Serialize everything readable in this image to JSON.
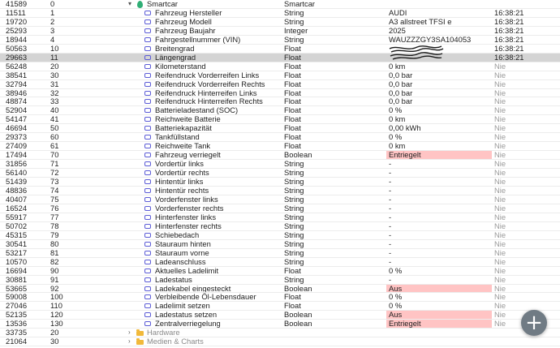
{
  "rows": [
    {
      "id": "41589",
      "num": "0",
      "name": "Smartcar",
      "type": "Smartcar",
      "value": "",
      "time": "",
      "kind": "group-open"
    },
    {
      "id": "11511",
      "num": "1",
      "name": "Fahrzeug Hersteller",
      "type": "String",
      "value": "AUDI",
      "time": "16:38:21",
      "kind": "var"
    },
    {
      "id": "19720",
      "num": "2",
      "name": "Fahrzeug Modell",
      "type": "String",
      "value": "A3 allstreet TFSI e",
      "time": "16:38:21",
      "kind": "var"
    },
    {
      "id": "25293",
      "num": "3",
      "name": "Fahrzeug Baujahr",
      "type": "Integer",
      "value": "2025",
      "time": "16:38:21",
      "kind": "var"
    },
    {
      "id": "18944",
      "num": "4",
      "name": "Fahrgestellnummer (VIN)",
      "type": "String",
      "value": "WAUZZZGY3SA104053",
      "time": "16:38:21",
      "kind": "var"
    },
    {
      "id": "50563",
      "num": "10",
      "name": "Breitengrad",
      "type": "Float",
      "value": "",
      "time": "16:38:21",
      "kind": "var"
    },
    {
      "id": "29663",
      "num": "11",
      "name": "Längengrad",
      "type": "Float",
      "value": "",
      "time": "16:38:21",
      "kind": "var",
      "selected": true
    },
    {
      "id": "56248",
      "num": "20",
      "name": "Kilometerstand",
      "type": "Float",
      "value": "0 km",
      "time": "Nie",
      "kind": "var"
    },
    {
      "id": "38541",
      "num": "30",
      "name": "Reifendruck Vorderreifen Links",
      "type": "Float",
      "value": "0,0 bar",
      "time": "Nie",
      "kind": "var"
    },
    {
      "id": "32794",
      "num": "31",
      "name": "Reifendruck Vorderreifen Rechts",
      "type": "Float",
      "value": "0,0 bar",
      "time": "Nie",
      "kind": "var"
    },
    {
      "id": "38946",
      "num": "32",
      "name": "Reifendruck Hinterreifen Links",
      "type": "Float",
      "value": "0,0 bar",
      "time": "Nie",
      "kind": "var"
    },
    {
      "id": "48874",
      "num": "33",
      "name": "Reifendruck Hinterreifen Rechts",
      "type": "Float",
      "value": "0,0 bar",
      "time": "Nie",
      "kind": "var"
    },
    {
      "id": "52904",
      "num": "40",
      "name": "Batterieladestand (SOC)",
      "type": "Float",
      "value": "0 %",
      "time": "Nie",
      "kind": "var"
    },
    {
      "id": "54147",
      "num": "41",
      "name": "Reichweite Batterie",
      "type": "Float",
      "value": "0 km",
      "time": "Nie",
      "kind": "var"
    },
    {
      "id": "46694",
      "num": "50",
      "name": "Batteriekapazität",
      "type": "Float",
      "value": "0,00 kWh",
      "time": "Nie",
      "kind": "var"
    },
    {
      "id": "29373",
      "num": "60",
      "name": "Tankfüllstand",
      "type": "Float",
      "value": "0 %",
      "time": "Nie",
      "kind": "var"
    },
    {
      "id": "27409",
      "num": "61",
      "name": "Reichweite Tank",
      "type": "Float",
      "value": "0 km",
      "time": "Nie",
      "kind": "var"
    },
    {
      "id": "17494",
      "num": "70",
      "name": "Fahrzeug verriegelt",
      "type": "Boolean",
      "value": "Entriegelt",
      "time": "Nie",
      "kind": "var",
      "highlight": true
    },
    {
      "id": "31856",
      "num": "71",
      "name": "Vordertür links",
      "type": "String",
      "value": "-",
      "time": "Nie",
      "kind": "var"
    },
    {
      "id": "56140",
      "num": "72",
      "name": "Vordertür rechts",
      "type": "String",
      "value": "-",
      "time": "Nie",
      "kind": "var"
    },
    {
      "id": "51439",
      "num": "73",
      "name": "Hintentür links",
      "type": "String",
      "value": "-",
      "time": "Nie",
      "kind": "var"
    },
    {
      "id": "48836",
      "num": "74",
      "name": "Hintentür rechts",
      "type": "String",
      "value": "-",
      "time": "Nie",
      "kind": "var"
    },
    {
      "id": "40407",
      "num": "75",
      "name": "Vorderfenster links",
      "type": "String",
      "value": "-",
      "time": "Nie",
      "kind": "var"
    },
    {
      "id": "16524",
      "num": "76",
      "name": "Vorderfenster rechts",
      "type": "String",
      "value": "-",
      "time": "Nie",
      "kind": "var"
    },
    {
      "id": "55917",
      "num": "77",
      "name": "Hinterfenster links",
      "type": "String",
      "value": "-",
      "time": "Nie",
      "kind": "var"
    },
    {
      "id": "50702",
      "num": "78",
      "name": "Hinterfenster rechts",
      "type": "String",
      "value": "-",
      "time": "Nie",
      "kind": "var"
    },
    {
      "id": "45315",
      "num": "79",
      "name": "Schiebedach",
      "type": "String",
      "value": "-",
      "time": "Nie",
      "kind": "var"
    },
    {
      "id": "30541",
      "num": "80",
      "name": "Stauraum hinten",
      "type": "String",
      "value": "-",
      "time": "Nie",
      "kind": "var"
    },
    {
      "id": "53217",
      "num": "81",
      "name": "Stauraum vorne",
      "type": "String",
      "value": "-",
      "time": "Nie",
      "kind": "var"
    },
    {
      "id": "10570",
      "num": "82",
      "name": "Ladeanschluss",
      "type": "String",
      "value": "-",
      "time": "Nie",
      "kind": "var"
    },
    {
      "id": "16694",
      "num": "90",
      "name": "Aktuelles Ladelimit",
      "type": "Float",
      "value": "0 %",
      "time": "Nie",
      "kind": "var"
    },
    {
      "id": "30881",
      "num": "91",
      "name": "Ladestatus",
      "type": "String",
      "value": "-",
      "time": "Nie",
      "kind": "var"
    },
    {
      "id": "53665",
      "num": "92",
      "name": "Ladekabel eingesteckt",
      "type": "Boolean",
      "value": "Aus",
      "time": "Nie",
      "kind": "var",
      "highlight": true
    },
    {
      "id": "59008",
      "num": "100",
      "name": "Verbleibende Öl-Lebensdauer",
      "type": "Float",
      "value": "0 %",
      "time": "Nie",
      "kind": "var"
    },
    {
      "id": "27046",
      "num": "110",
      "name": "Ladelimit setzen",
      "type": "Float",
      "value": "0 %",
      "time": "Nie",
      "kind": "var"
    },
    {
      "id": "52135",
      "num": "120",
      "name": "Ladestatus setzen",
      "type": "Boolean",
      "value": "Aus",
      "time": "Nie",
      "kind": "var",
      "highlight": true
    },
    {
      "id": "13536",
      "num": "130",
      "name": "Zentralverriegelung",
      "type": "Boolean",
      "value": "Entriegelt",
      "time": "Nie",
      "kind": "var",
      "highlight": true
    },
    {
      "id": "33735",
      "num": "20",
      "name": "Hardware",
      "type": "",
      "value": "",
      "time": "",
      "kind": "group-closed"
    },
    {
      "id": "21064",
      "num": "30",
      "name": "Medien & Charts",
      "type": "",
      "value": "",
      "time": "",
      "kind": "group-closed"
    }
  ],
  "colors": {
    "highlight": "#ffc4c4",
    "selected_row": "#d4d4d4",
    "variable_icon": "#5b5bd6",
    "folder_icon": "#f1b93a",
    "smartcar_icon": "#2fae75",
    "fab": "#707b84"
  },
  "icons": {
    "variable": "variable-icon",
    "folder": "folder-icon",
    "smartcar": "smartcar-icon",
    "expand_open": "chevron-down-icon",
    "expand_closed": "chevron-right-icon",
    "fab": "plus-icon"
  },
  "fab": {
    "label": "+"
  }
}
